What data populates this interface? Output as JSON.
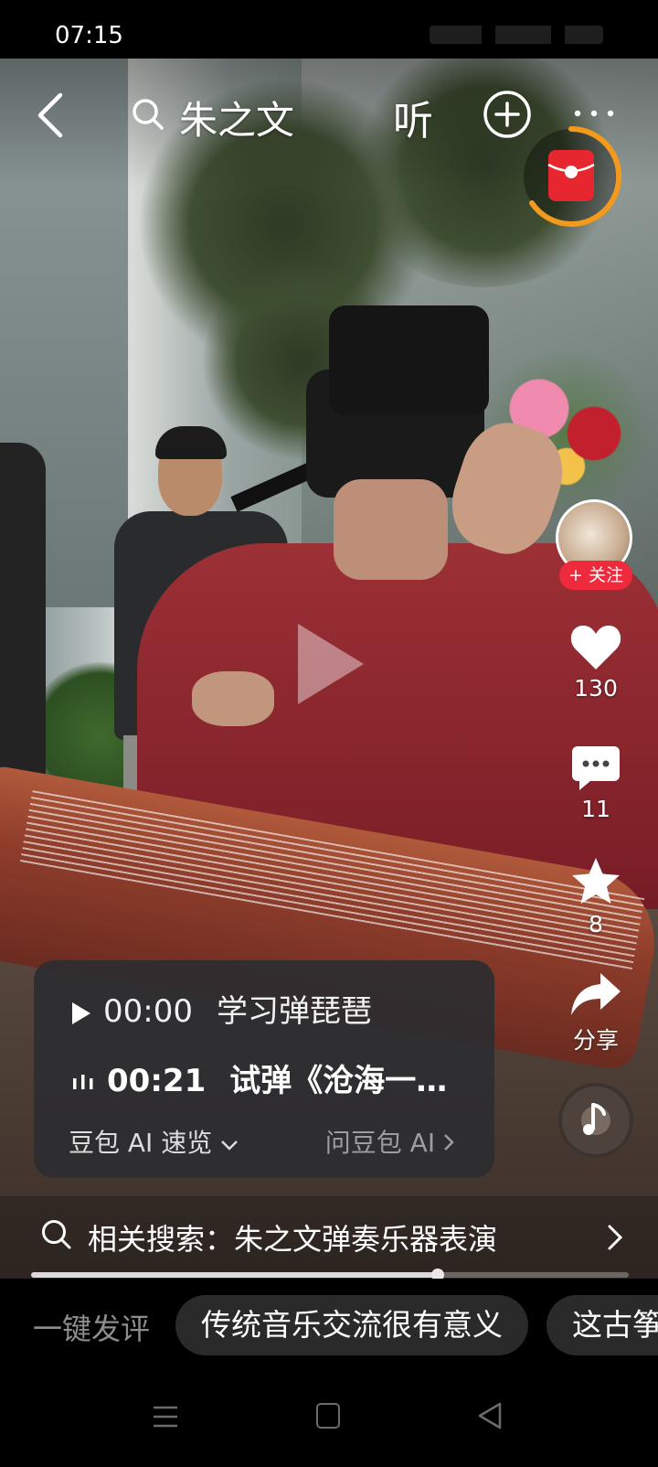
{
  "status_bar": {
    "time": "07:15"
  },
  "top_bar": {
    "search_text": "朱之文",
    "listen_label": "听"
  },
  "rail": {
    "follow_label": "+ 关注",
    "like_count": "130",
    "comment_count": "11",
    "favorite_count": "8",
    "share_label": "分享"
  },
  "info_card": {
    "chapters": [
      {
        "time": "00:00",
        "title": "学习弹琵琶"
      },
      {
        "time": "00:21",
        "title": "试弹《沧海一…"
      }
    ],
    "summary_label": "豆包 AI 速览",
    "ask_label": "问豆包 AI"
  },
  "related_search": {
    "text": "相关搜索：朱之文弹奏乐器表演"
  },
  "progress": {
    "fraction": 0.68
  },
  "comment_bar": {
    "label": "一键发评",
    "chips": [
      "传统音乐交流很有意义",
      "这古筝"
    ]
  },
  "colors": {
    "accent_red": "#ee2a3c",
    "card_bg": "#2c2c30",
    "redpack_ring": "#f39a1c"
  },
  "icons": [
    "back-icon",
    "search-icon",
    "add-icon",
    "more-icon",
    "heart-icon",
    "comment-icon",
    "star-icon",
    "share-icon",
    "music-icon"
  ]
}
